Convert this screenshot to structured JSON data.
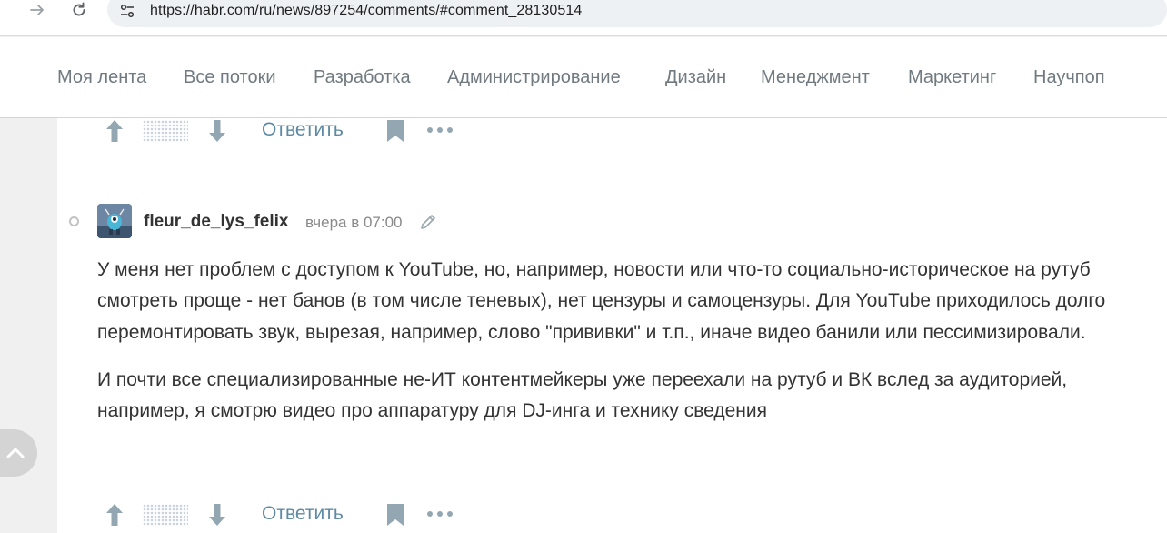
{
  "browser": {
    "url": "https://habr.com/ru/news/897254/comments/#comment_28130514",
    "icons": [
      "arrow-forward-icon",
      "reload-icon",
      "site-info-icon"
    ]
  },
  "habr_nav": {
    "items": [
      "Моя лента",
      "Все потоки",
      "Разработка",
      "Администрирование",
      "Дизайн",
      "Менеджмент",
      "Маркетинг",
      "Научпоп"
    ]
  },
  "actions": {
    "reply_label": "Ответить",
    "icons": [
      "vote-up-icon",
      "vote-down-icon",
      "bookmark-icon",
      "more-icon"
    ]
  },
  "comment": {
    "username": "fleur_de_lys_felix",
    "time": "вчера в 07:00",
    "paragraphs": [
      "У меня нет проблем с доступом к YouTube, но, например, новости или что-то социально-историческое на рутуб смотреть проще - нет банов (в том числе теневых), нет цензуры и самоцензуры. Для YouTube приходилось долго перемонтировать звук, вырезая, например, слово \"прививки\" и т.п., иначе видео банили или пессимизировали.",
      "И почти все специализированные не-ИТ контентмейкеры уже переехали на рутуб и ВК вслед за аудиторией, например, я смотрю видео про аппаратуру для DJ-инга и технику сведения"
    ]
  },
  "colors": {
    "link": "#5e8aa3",
    "nav_text": "#707a80",
    "body_text": "#333333",
    "page_bg": "#f0f0f0"
  }
}
